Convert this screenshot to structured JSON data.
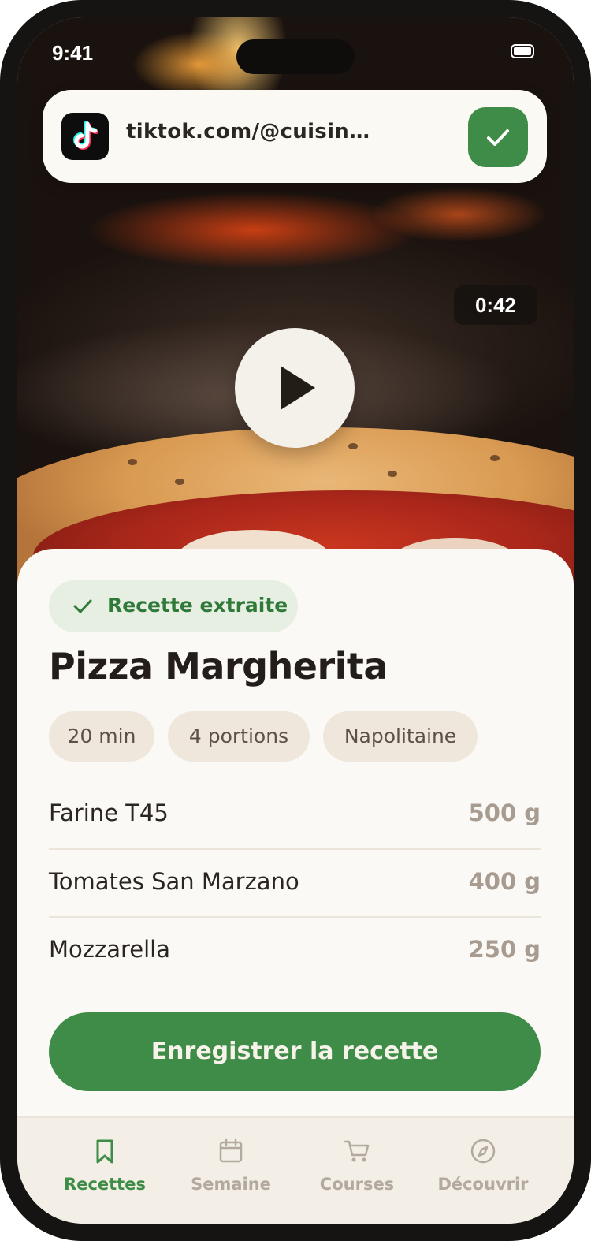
{
  "status_bar": {
    "time": "9:41"
  },
  "source": {
    "platform_icon": "tiktok-icon",
    "url": "tiktok.com/@cuisinedemam…",
    "confirm_icon": "check-icon"
  },
  "video": {
    "duration": "0:42",
    "play_icon": "play-icon"
  },
  "recipe": {
    "badge": "Recette extraite",
    "title": "Pizza Margherita",
    "chips": [
      "20 min",
      "4 portions",
      "Napolitaine"
    ],
    "ingredients": [
      {
        "name": "Farine T45",
        "qty": "500 g"
      },
      {
        "name": "Tomates San Marzano",
        "qty": "400 g"
      },
      {
        "name": "Mozzarella",
        "qty": "250 g"
      }
    ],
    "save_label": "Enregistrer la recette"
  },
  "tabs": [
    {
      "label": "Recettes",
      "icon": "bookmark-icon",
      "active": true
    },
    {
      "label": "Semaine",
      "icon": "calendar-icon",
      "active": false
    },
    {
      "label": "Courses",
      "icon": "cart-icon",
      "active": false
    },
    {
      "label": "Découvrir",
      "icon": "compass-icon",
      "active": false
    }
  ],
  "colors": {
    "accent": "#3e8c47",
    "active_tab": "#3e8c47",
    "inactive_tab": "#b3a99f",
    "sheet_bg": "#fbf9f5"
  }
}
